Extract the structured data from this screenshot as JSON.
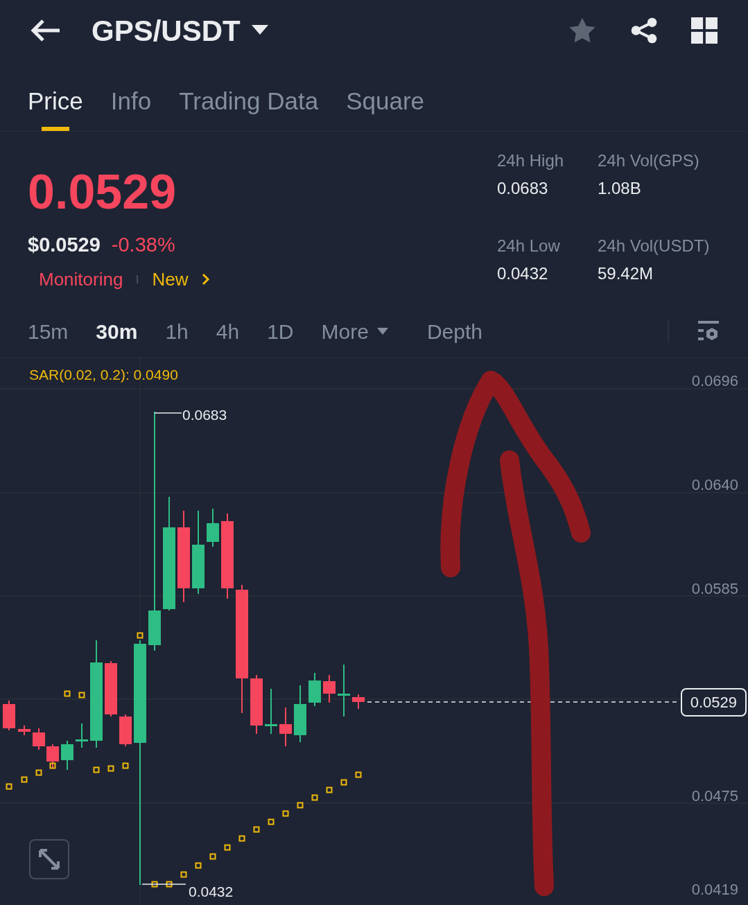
{
  "header": {
    "title": "GPS/USDT",
    "favorite": false
  },
  "tabs": [
    {
      "label": "Price",
      "selected": true
    },
    {
      "label": "Info",
      "selected": false
    },
    {
      "label": "Trading Data",
      "selected": false
    },
    {
      "label": "Square",
      "selected": false
    }
  ],
  "price": {
    "last": "0.0529",
    "usd": "$0.0529",
    "change": "-0.38%",
    "tags": [
      {
        "label": "Monitoring",
        "kind": "warning"
      },
      {
        "label": "New",
        "kind": "new"
      }
    ]
  },
  "stats": [
    {
      "label": "24h High",
      "value": "0.0683"
    },
    {
      "label": "24h Vol(GPS)",
      "value": "1.08B"
    },
    {
      "label": "24h Low",
      "value": "0.0432"
    },
    {
      "label": "24h Vol(USDT)",
      "value": "59.42M"
    }
  ],
  "intervals": [
    {
      "label": "15m",
      "selected": false
    },
    {
      "label": "30m",
      "selected": true
    },
    {
      "label": "1h",
      "selected": false
    },
    {
      "label": "4h",
      "selected": false
    },
    {
      "label": "1D",
      "selected": false
    }
  ],
  "more": "More",
  "depth": "Depth",
  "chart": {
    "indicator_label": "SAR(0.02, 0.2):",
    "indicator_value": "0.0490",
    "price_axis": [
      "0.0696",
      "0.0640",
      "0.0585",
      "0.0475",
      "0.0419"
    ],
    "high_label": "0.0683",
    "low_label": "0.0432",
    "current_price": "0.0529"
  }
}
